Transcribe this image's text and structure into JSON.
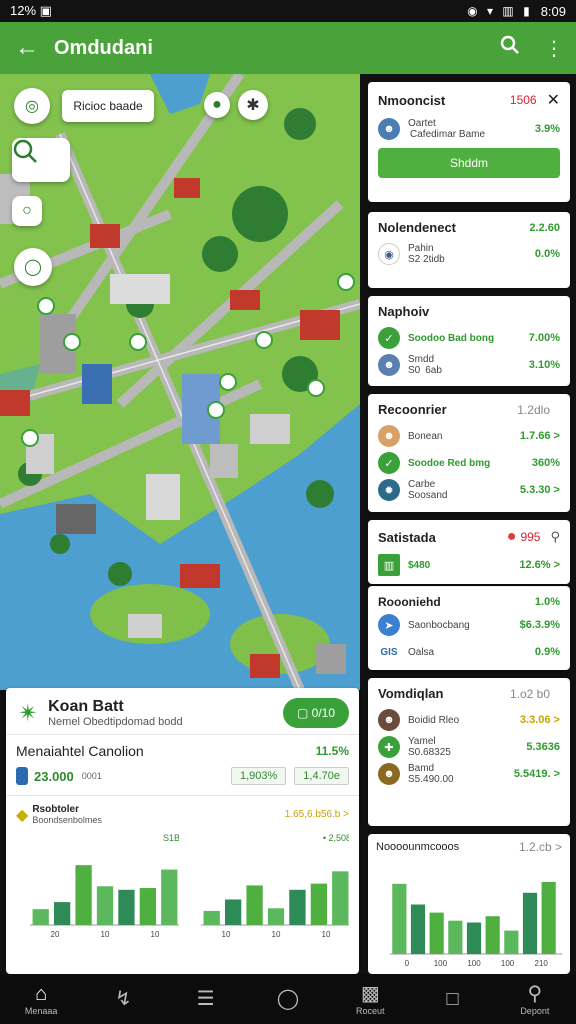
{
  "status": {
    "left": "12% ▣",
    "icons": "◉ ▾ ▥ ▮",
    "time": "8:09"
  },
  "appbar": {
    "title": "Omdudani",
    "back_icon": "arrow-left-icon",
    "search_icon": "search-icon",
    "more_icon": "more-vert-icon"
  },
  "map": {
    "chip_label": "Ricioc baade"
  },
  "cards": {
    "c1": {
      "title": "Nmooncist",
      "value": "1506",
      "rows": [
        {
          "label": "Oartet\n Cafedimar Bame",
          "value": "3.9%"
        }
      ],
      "button": "Shddm"
    },
    "c2": {
      "title": "Nolendenect",
      "rows": [
        {
          "label": "Pahin\nS2 2tidb",
          "value": "2.2.60",
          "value2": "0.0%"
        }
      ]
    },
    "c3": {
      "title": "Naphoiv",
      "value": "",
      "rows": [
        {
          "label": "Soodoo Bad bong",
          "value": "7.00%"
        },
        {
          "label": "Smdd\nS0 6ab",
          "value": "3.10%"
        }
      ]
    },
    "c4": {
      "title": "Recoonrier",
      "value": "1.2dlo",
      "rows": [
        {
          "label": "Bonean",
          "value": "1.7.66 >"
        },
        {
          "label": "Soodoe Red bmg",
          "value": "360%"
        },
        {
          "label": "Carbe\nSoosand",
          "value": "5.3.30 >"
        }
      ]
    },
    "c5": {
      "title": "Satistada",
      "value": "995",
      "rows": [
        {
          "label": "$480",
          "value": "12.6% >"
        }
      ]
    },
    "c6": {
      "title": "Roooniehd",
      "value": "1.0%",
      "rows": [
        {
          "label": "Saonbocbang",
          "value": "$6.3.9%"
        },
        {
          "label": "Oalsa",
          "value": "0.9%"
        }
      ]
    },
    "c7": {
      "title": "Vomdiqlan",
      "value": "1.o2 b0",
      "rows": [
        {
          "label": "Boidid Rleo",
          "value": "3.3.06 >"
        },
        {
          "label": "Yamel\nS0.68325",
          "value": "5.3636"
        },
        {
          "label": "Bamd\nS5.490.00",
          "value": "5.5419. >"
        }
      ]
    },
    "c8": {
      "title": "Noooounmcooos",
      "value": "1.2.cb >",
      "chart_axis": [
        "0",
        "100",
        "100",
        "100",
        "210"
      ]
    }
  },
  "bottom": {
    "title": "Koan Batt",
    "subtitle": "Nemel Obedtipdomad bodd",
    "pill": "▢ 0/10",
    "section_title": "Menaiahtel Canolion",
    "section_value": "11.5%",
    "amount": "23.000",
    "amount_unit": "0001",
    "tag1": "1,903%",
    "tag2": "1,4.70e",
    "chart_head": "Rsobtoler",
    "chart_sub": "Boondsenbolmes",
    "chart_value": "1.65,6.b56.b >",
    "mini1_label": "S1B",
    "mini2_label": "• 2,508",
    "axis1": [
      "20",
      "10",
      "10"
    ],
    "axis2": [
      "10",
      "10",
      "10"
    ]
  },
  "chart_data": [
    {
      "type": "bar",
      "categories": [
        "1",
        "2",
        "3",
        "4",
        "5",
        "6",
        "7"
      ],
      "values": [
        18,
        26,
        68,
        44,
        40,
        42,
        63
      ]
    },
    {
      "type": "bar",
      "categories": [
        "1",
        "2",
        "3",
        "4",
        "5",
        "6",
        "7"
      ],
      "values": [
        16,
        29,
        45,
        19,
        40,
        47,
        61
      ]
    },
    {
      "type": "bar",
      "categories": [
        "1",
        "2",
        "3",
        "4",
        "5",
        "6",
        "7",
        "8",
        "9"
      ],
      "values": [
        78,
        55,
        46,
        37,
        35,
        42,
        26,
        68,
        80
      ]
    }
  ],
  "nav": [
    {
      "label": "Menaaa",
      "icon": "home-icon"
    },
    {
      "label": "",
      "icon": "route-icon"
    },
    {
      "label": "",
      "icon": "list-icon"
    },
    {
      "label": "",
      "icon": "circle-icon"
    },
    {
      "label": "Roceut",
      "icon": "report-icon"
    },
    {
      "label": "",
      "icon": "square-icon"
    },
    {
      "label": "Depont",
      "icon": "person-icon"
    }
  ]
}
